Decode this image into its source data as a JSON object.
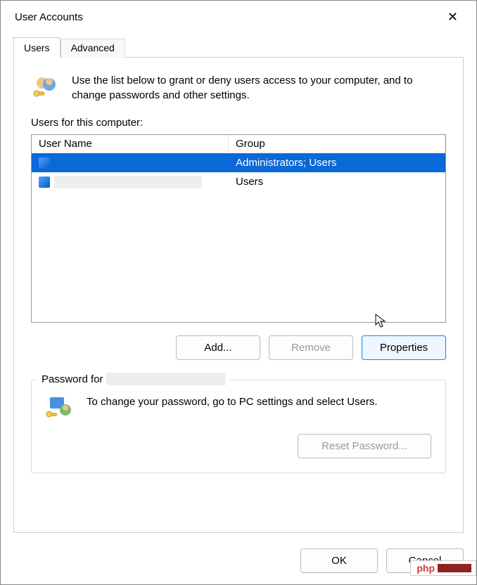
{
  "window": {
    "title": "User Accounts",
    "close_glyph": "✕"
  },
  "tabs": [
    {
      "label": "Users",
      "active": true
    },
    {
      "label": "Advanced",
      "active": false
    }
  ],
  "intro": {
    "text": "Use the list below to grant or deny users access to your computer, and to change passwords and other settings."
  },
  "users_section": {
    "label": "Users for this computer:",
    "columns": {
      "user": "User Name",
      "group": "Group"
    },
    "rows": [
      {
        "username": "",
        "group": "Administrators; Users",
        "selected": true
      },
      {
        "username": "",
        "group": "Users",
        "selected": false
      }
    ]
  },
  "user_buttons": {
    "add": "Add...",
    "remove": "Remove",
    "properties": "Properties"
  },
  "password_section": {
    "legend_prefix": "Password for",
    "legend_user": "",
    "text": "To change your password, go to PC settings and select Users.",
    "reset_label": "Reset Password..."
  },
  "footer": {
    "ok": "OK",
    "cancel": "Cancel"
  },
  "watermark": {
    "text": "php"
  }
}
